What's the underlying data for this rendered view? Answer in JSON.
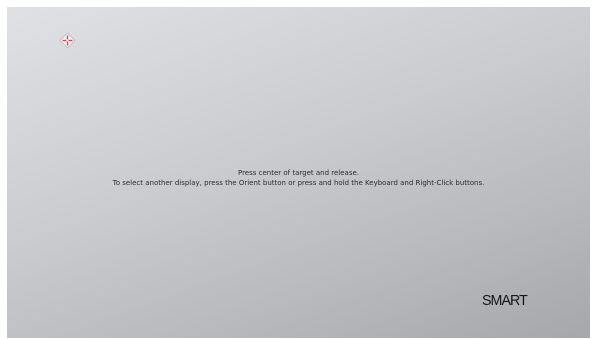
{
  "calibration": {
    "line1": "Press center of target and release.",
    "line2": "To select another display, press the Orient button or press and hold the Keyboard and Right-Click buttons."
  },
  "branding": {
    "logo_text": "SMART"
  },
  "colors": {
    "target_fill": "#f2f2f2",
    "target_accent": "#d9473f"
  },
  "icons": {
    "target": "calibration-target-icon"
  }
}
